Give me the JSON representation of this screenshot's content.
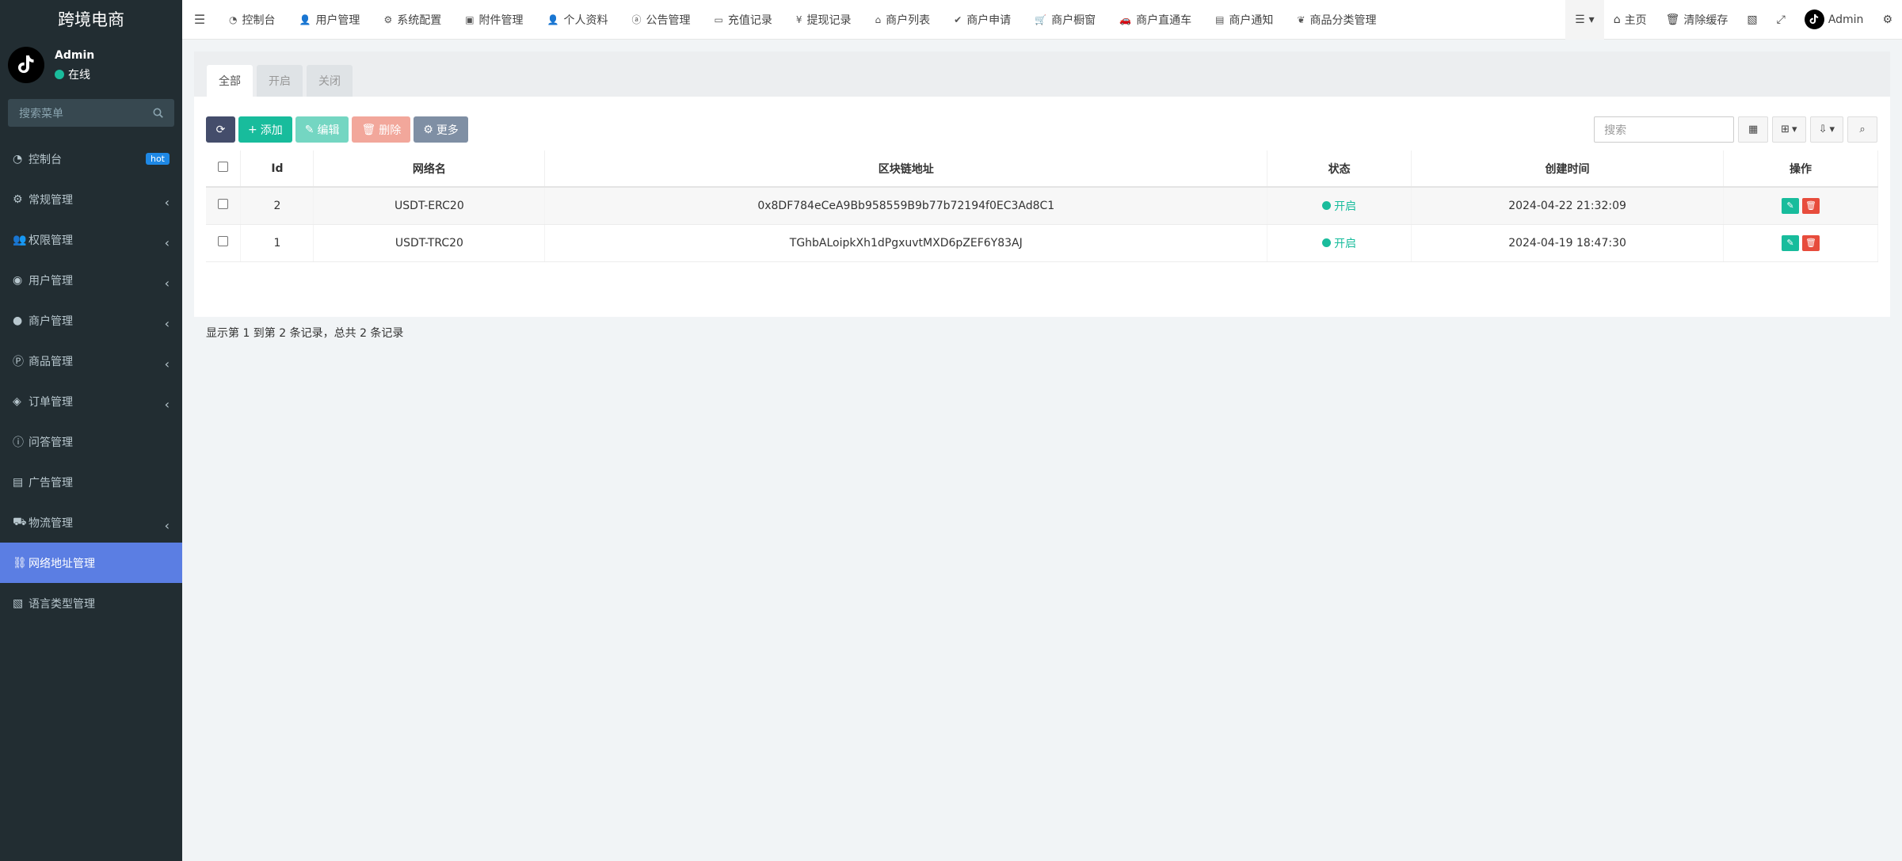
{
  "brand": {
    "title": "跨境电商"
  },
  "user": {
    "name": "Admin",
    "status": "在线"
  },
  "sidebar": {
    "search_placeholder": "搜索菜单",
    "hot_badge": "hot",
    "items": [
      {
        "label": "控制台",
        "icon": "dashboard-icon"
      },
      {
        "label": "常规管理",
        "icon": "cogs-icon"
      },
      {
        "label": "权限管理",
        "icon": "users-icon"
      },
      {
        "label": "用户管理",
        "icon": "user-circle-icon"
      },
      {
        "label": "商户管理",
        "icon": "apple-icon"
      },
      {
        "label": "商品管理",
        "icon": "product-icon"
      },
      {
        "label": "订单管理",
        "icon": "cube-icon"
      },
      {
        "label": "问答管理",
        "icon": "question-icon"
      },
      {
        "label": "广告管理",
        "icon": "ad-icon"
      },
      {
        "label": "物流管理",
        "icon": "truck-icon"
      },
      {
        "label": "网络地址管理",
        "icon": "link-icon"
      },
      {
        "label": "语言类型管理",
        "icon": "language-icon"
      }
    ]
  },
  "navbar": {
    "tabs": [
      {
        "label": "控制台",
        "icon": "dashboard-icon"
      },
      {
        "label": "用户管理",
        "icon": "user-icon"
      },
      {
        "label": "系统配置",
        "icon": "cog-icon"
      },
      {
        "label": "附件管理",
        "icon": "image-icon"
      },
      {
        "label": "个人资料",
        "icon": "user-icon"
      },
      {
        "label": "公告管理",
        "icon": "amazon-icon"
      },
      {
        "label": "充值记录",
        "icon": "money-icon"
      },
      {
        "label": "提现记录",
        "icon": "yen-icon"
      },
      {
        "label": "商户列表",
        "icon": "home-icon"
      },
      {
        "label": "商户申请",
        "icon": "check-circle-icon"
      },
      {
        "label": "商户橱窗",
        "icon": "cart-icon"
      },
      {
        "label": "商户直通车",
        "icon": "car-icon"
      },
      {
        "label": "商户通知",
        "icon": "list-alt-icon"
      },
      {
        "label": "商品分类管理",
        "icon": "leaf-icon"
      }
    ],
    "home": "主页",
    "clear_cache": "清除缓存",
    "admin": "Admin"
  },
  "content": {
    "tabs": [
      "全部",
      "开启",
      "关闭"
    ],
    "toolbar": {
      "add": "添加",
      "edit": "编辑",
      "delete": "删除",
      "more": "更多"
    },
    "search_placeholder": "搜索",
    "table": {
      "headers": [
        "Id",
        "网络名",
        "区块链地址",
        "状态",
        "创建时间",
        "操作"
      ],
      "rows": [
        {
          "id": "2",
          "name": "USDT-ERC20",
          "address": "0x8DF784eCeA9Bb958559B9b77b72194f0EC3Ad8C1",
          "status": "开启",
          "created": "2024-04-22 21:32:09"
        },
        {
          "id": "1",
          "name": "USDT-TRC20",
          "address": "TGhbALoipkXh1dPgxuvtMXD6pZEF6Y83AJ",
          "status": "开启",
          "created": "2024-04-19 18:47:30"
        }
      ]
    },
    "pager": "显示第 1 到第 2 条记录，总共 2 条记录"
  },
  "colors": {
    "sidebar_bg": "#222d32",
    "active": "#5b7ee3",
    "green": "#18bc9c",
    "red": "#e74c3c"
  }
}
